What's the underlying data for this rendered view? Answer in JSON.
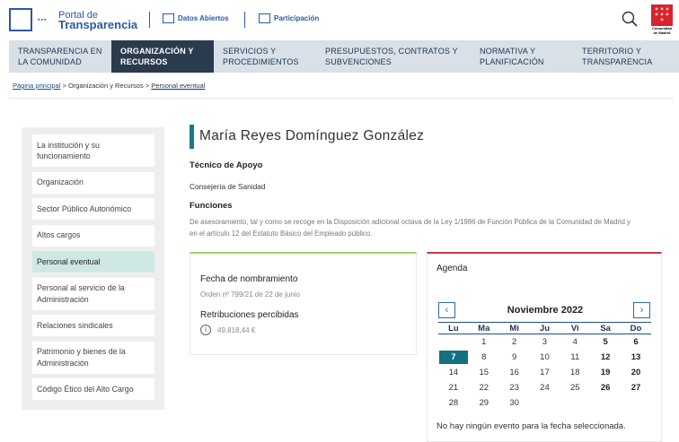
{
  "header": {
    "portal_small": "Portal de",
    "portal_big": "Transparencia",
    "logo_dots": "▪▪▪",
    "links": [
      {
        "label": "Datos Abiertos",
        "icon": "chart-icon"
      },
      {
        "label": "Participación",
        "icon": "chat-icon"
      }
    ],
    "cm_label": "Comunidad de Madrid",
    "brand_color": "#2c5aa0",
    "cm_color": "#d8232a"
  },
  "nav": {
    "items": [
      {
        "label": "TRANSPARENCIA EN LA COMUNIDAD",
        "active": false
      },
      {
        "label": "ORGANIZACIÓN Y RECURSOS",
        "active": true
      },
      {
        "label": "SERVICIOS Y PROCEDIMIENTOS",
        "active": false
      },
      {
        "label": "PRESUPUESTOS, CONTRATOS Y SUBVENCIONES",
        "active": false
      },
      {
        "label": "NORMATIVA Y PLANIFICACIÓN",
        "active": false
      },
      {
        "label": "TERRITORIO Y TRANSPARENCIA",
        "active": false
      }
    ]
  },
  "breadcrumb": {
    "home": "Página principal",
    "sep1": " > ",
    "middle": "Organización y Recursos",
    "sep2": " > ",
    "current": "Personal eventual"
  },
  "sidebar": {
    "items": [
      {
        "label": "La institución y su funcionamiento",
        "active": false
      },
      {
        "label": "Organización",
        "active": false
      },
      {
        "label": "Sector Público Autonómico",
        "active": false
      },
      {
        "label": "Altos cargos",
        "active": false
      },
      {
        "label": "Personal eventual",
        "active": true
      },
      {
        "label": "Personal al servicio de la Administración",
        "active": false
      },
      {
        "label": "Relaciones sindicales",
        "active": false
      },
      {
        "label": "Patrimonio y bienes de la Administración",
        "active": false
      },
      {
        "label": "Código Ético del Alto Cargo",
        "active": false
      }
    ]
  },
  "profile": {
    "name": "María Reyes Domínguez González",
    "role": "Técnico de Apoyo",
    "department": "Consejería de Sanidad",
    "functions_heading": "Funciones",
    "functions_text": "De asesoramiento, tal y como se recoge en la Disposición adicional octava de la Ley 1/1986 de Función Pública de la Comunidad de Madrid y en el artículo 12 del Estatuto Básico del Empleado público."
  },
  "appointment": {
    "fecha_heading": "Fecha de nombramiento",
    "fecha_value": "Orden nº 799/21 de 22 de junio",
    "retribuciones_heading": "Retribuciones percibidas",
    "retribuciones_value": "49.818,44 €",
    "info_glyph": "i"
  },
  "agenda": {
    "heading": "Agenda",
    "prev": "‹",
    "next": "›",
    "month_title": "Noviembre 2022",
    "weekdays": [
      "Lu",
      "Ma",
      "Mi",
      "Ju",
      "Vi",
      "Sa",
      "Do"
    ],
    "weeks": [
      [
        "",
        "1",
        "2",
        "3",
        "4",
        "5",
        "6"
      ],
      [
        "7",
        "8",
        "9",
        "10",
        "11",
        "12",
        "13"
      ],
      [
        "14",
        "15",
        "16",
        "17",
        "18",
        "19",
        "20"
      ],
      [
        "21",
        "22",
        "23",
        "24",
        "25",
        "26",
        "27"
      ],
      [
        "28",
        "29",
        "30",
        "",
        "",
        "",
        ""
      ]
    ],
    "selected_day": "7",
    "no_events": "No hay ningún evento para la fecha seleccionada."
  }
}
